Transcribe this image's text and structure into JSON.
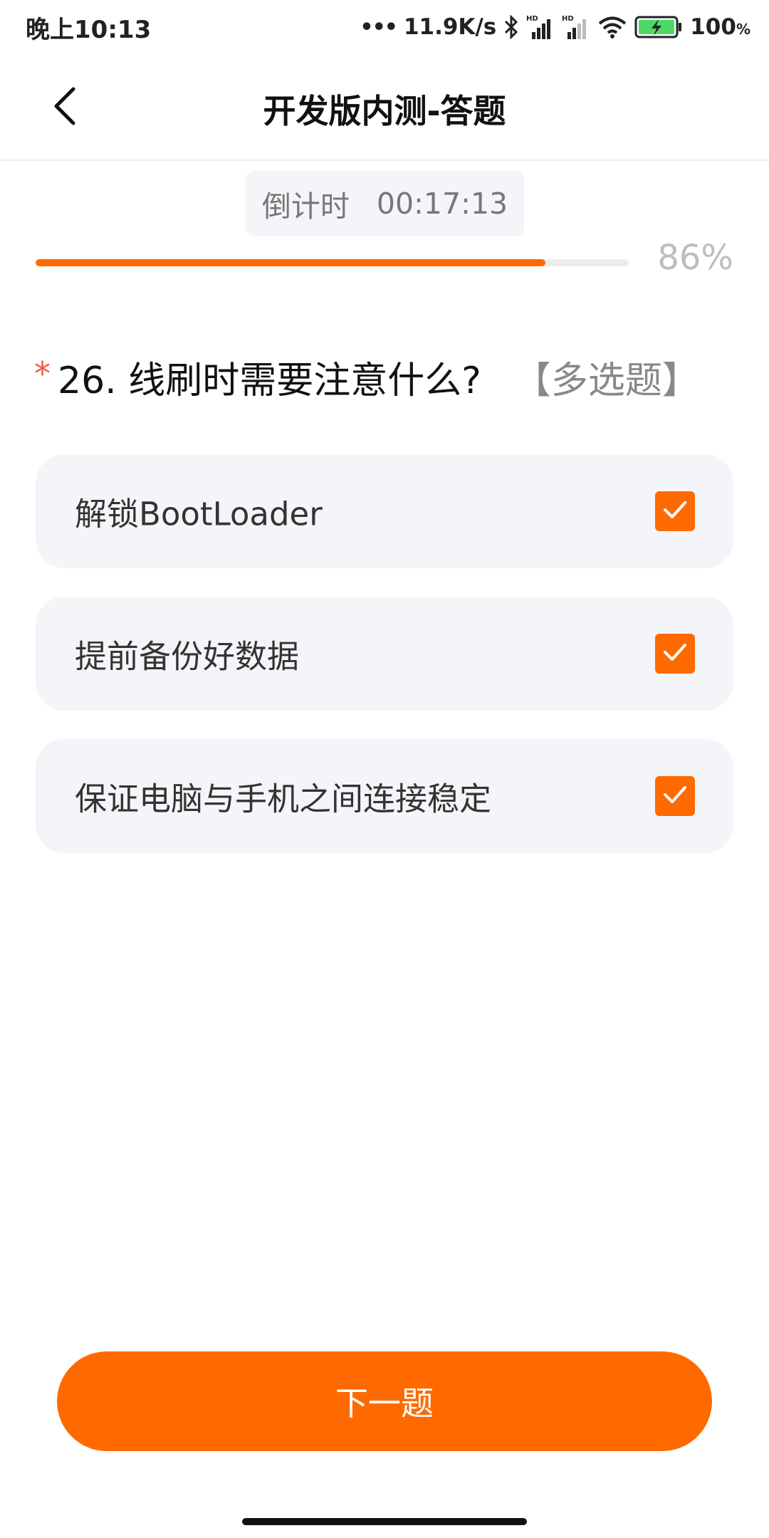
{
  "status_bar": {
    "time": "晚上10:13",
    "dots": "•••",
    "speed": "11.9K/s",
    "battery_value": "100",
    "battery_unit": "%",
    "icons": [
      "bluetooth-icon",
      "signal-hd-icon",
      "signal-hd-icon",
      "wifi-icon",
      "battery-charging-icon"
    ]
  },
  "header": {
    "title": "开发版内测-答题",
    "back_icon": "chevron-left-icon"
  },
  "countdown": {
    "label": "倒计时",
    "value": "00:17:13"
  },
  "progress": {
    "percent_text": "86%",
    "value": 0.86
  },
  "question": {
    "required_mark": "*",
    "text": "26. 线刷时需要注意什么?",
    "type": "【多选题】"
  },
  "options": [
    {
      "label": "解锁BootLoader",
      "checked": true
    },
    {
      "label": "提前备份好数据",
      "checked": true
    },
    {
      "label": "保证电脑与手机之间连接稳定",
      "checked": true
    }
  ],
  "next_button": {
    "label": "下一题"
  },
  "colors": {
    "accent": "#ff6a00",
    "required": "#f25a4a",
    "option_bg": "#f4f5f9"
  }
}
